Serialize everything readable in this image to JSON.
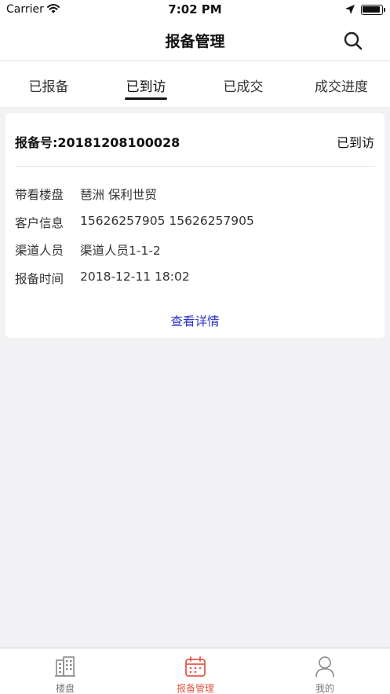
{
  "status_bar": {
    "carrier": "Carrier",
    "time": "7:02 PM"
  },
  "nav": {
    "title": "报备管理",
    "search_icon": "search-icon"
  },
  "tabs": [
    {
      "label": "已报备"
    },
    {
      "label": "已到访",
      "active": true
    },
    {
      "label": "已成交"
    },
    {
      "label": "成交进度"
    }
  ],
  "card": {
    "report_no": "报备号:20181208100028",
    "status": "已到访",
    "rows": [
      {
        "label": "带看楼盘",
        "value": "琶洲 保利世贸"
      },
      {
        "label": "客户信息",
        "value": "15626257905 15626257905"
      },
      {
        "label": "渠道人员",
        "value": "渠道人员1-1-2"
      },
      {
        "label": "报备时间",
        "value": "2018-12-11 18:02"
      }
    ],
    "detail_link": "查看详情"
  },
  "bottom_nav": [
    {
      "label": "楼盘",
      "icon": "building-icon"
    },
    {
      "label": "报备管理",
      "icon": "calendar-icon",
      "active": true
    },
    {
      "label": "我的",
      "icon": "user-icon"
    }
  ],
  "colors": {
    "accent": "#e25a4a",
    "link": "#2f35c8"
  }
}
